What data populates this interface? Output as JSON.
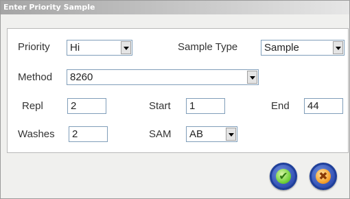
{
  "dialog": {
    "title": "Enter Priority Sample"
  },
  "form": {
    "priority": {
      "label": "Priority",
      "value": "Hi"
    },
    "sample_type": {
      "label": "Sample Type",
      "value": "Sample"
    },
    "method": {
      "label": "Method",
      "value": "8260"
    },
    "repl": {
      "label": "Repl",
      "value": "2"
    },
    "start": {
      "label": "Start",
      "value": "1"
    },
    "end": {
      "label": "End",
      "value": "44"
    },
    "washes": {
      "label": "Washes",
      "value": "2"
    },
    "sam": {
      "label": "SAM",
      "value": "AB"
    }
  },
  "buttons": {
    "ok_icon": "check-icon",
    "cancel_icon": "close-icon",
    "ok_glyph": "✔",
    "cancel_glyph": "✖"
  },
  "colors": {
    "button_ring": "#2b4bb0",
    "ok_fill": "#76d33e",
    "cancel_fill": "#f7a532"
  }
}
